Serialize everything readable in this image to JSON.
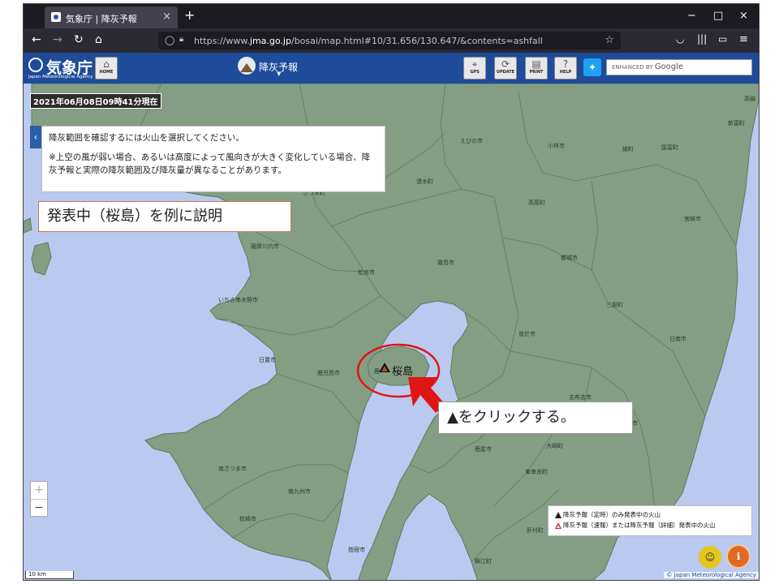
{
  "browser": {
    "tab_title": "気象庁 | 降灰予報",
    "new_tab": "+",
    "minimize": "−",
    "maximize": "□",
    "close": "×",
    "url_prefix": "https://www.",
    "url_host": "jma.go.jp",
    "url_path": "/bosai/map.html#10/31.656/130.647/&contents=ashfall",
    "icons": [
      "back-icon",
      "forward-icon",
      "reload-icon",
      "home-icon",
      "shield-icon",
      "lock-icon",
      "bookmark-star-icon",
      "pocket-icon",
      "library-icon",
      "sidebar-icon",
      "menu-icon"
    ]
  },
  "header": {
    "logo_kanji": "気象庁",
    "logo_english": "Japan Meteorological Agency",
    "home_label": "HOME",
    "title": "降灰予報",
    "buttons": [
      {
        "label": "GPS",
        "icon": "gps-icon"
      },
      {
        "label": "UPDATE",
        "icon": "update-icon"
      },
      {
        "label": "PRINT",
        "icon": "print-icon"
      },
      {
        "label": "HELP",
        "icon": "help-icon"
      }
    ],
    "search_placeholder": "ENHANCED BY",
    "search_brand": "Google"
  },
  "map": {
    "timestamp": "2021年06月08日09時41分現在",
    "info_line1": "降灰範囲を確認するには火山を選択してください。",
    "info_line2": "※上空の風が弱い場合、あるいは高度によって風向きが大きく変化している場合、降灰予報と実際の降灰範囲及び降灰量が異なることがあります。",
    "callout_top": "発表中（桜島）を例に説明",
    "callout_click": "▲をクリックする。",
    "volcano_name": "桜島",
    "zoom_in": "+",
    "zoom_out": "−",
    "legend_regular": "降灰予報（定時）のみ発表中の火山",
    "legend_detailed": "降灰予報（速報）または降灰予報（詳細）発表中の火山",
    "scale": "10 km",
    "copyright": "© Japan Meteorological Agency",
    "places": [
      {
        "name": "えびの市"
      },
      {
        "name": "小林市"
      },
      {
        "name": "綾町"
      },
      {
        "name": "国富町"
      },
      {
        "name": "新富町"
      },
      {
        "name": "高鍋"
      },
      {
        "name": "湧水町"
      },
      {
        "name": "高原町"
      },
      {
        "name": "宮崎市"
      },
      {
        "name": "さつま町"
      },
      {
        "name": "薩摩川内市"
      },
      {
        "name": "姶良市"
      },
      {
        "name": "霧島市"
      },
      {
        "name": "都城市"
      },
      {
        "name": "いちき串木野市"
      },
      {
        "name": "三股町"
      },
      {
        "name": "曽於市"
      },
      {
        "name": "日南市"
      },
      {
        "name": "日置市"
      },
      {
        "name": "鹿児島市"
      },
      {
        "name": "鹿"
      },
      {
        "name": "志布志市"
      },
      {
        "name": "串間市"
      },
      {
        "name": "南さつま市"
      },
      {
        "name": "鹿屋市"
      },
      {
        "name": "大崎町"
      },
      {
        "name": "東串良町"
      },
      {
        "name": "南九州市"
      },
      {
        "name": "枕崎市"
      },
      {
        "name": "指宿市"
      },
      {
        "name": "錦江町"
      },
      {
        "name": "肝付町"
      }
    ]
  },
  "colors": {
    "land": "#849e84",
    "sea": "#b9c9ef",
    "header_blue": "#1e4c9a",
    "highlight_red": "#e01515",
    "callout_border": "#c87b4a"
  }
}
